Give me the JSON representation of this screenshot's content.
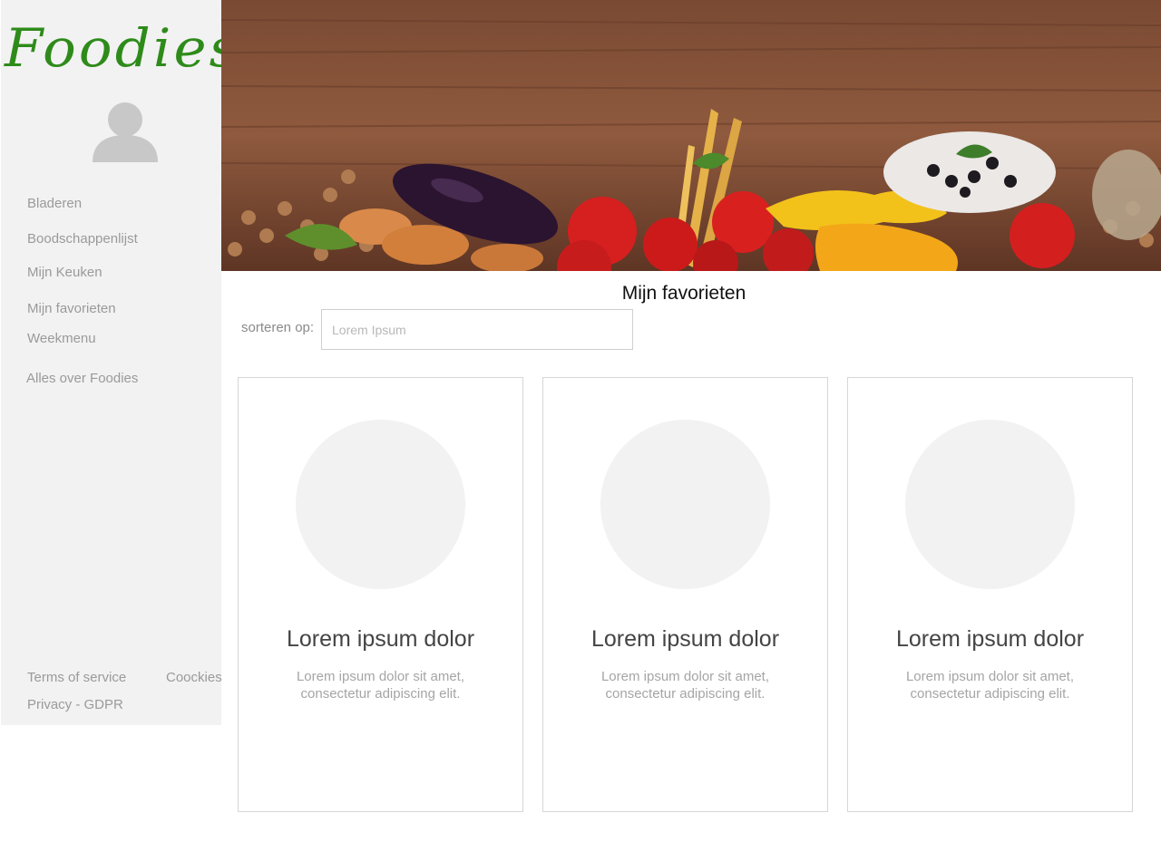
{
  "brand": {
    "logo_text": "Foodies",
    "logo_color": "#2e8b1a"
  },
  "sidebar": {
    "avatar_icon": "user-avatar-icon",
    "items": [
      {
        "label": "Bladeren"
      },
      {
        "label": "Boodschappenlijst"
      },
      {
        "label": "Mijn Keuken"
      },
      {
        "label": "Mijn favorieten"
      },
      {
        "label": "Weekmenu"
      },
      {
        "label": "Alles over Foodies"
      }
    ],
    "footer": {
      "terms": "Terms of service",
      "cookies": "Coockies",
      "privacy": "Privacy - GDPR"
    }
  },
  "hero": {
    "image_subject": "vegetables and pasta on wooden table"
  },
  "main": {
    "title": "Mijn favorieten",
    "sort": {
      "label": "sorteren op:",
      "placeholder": "Lorem Ipsum",
      "value": ""
    },
    "cards": [
      {
        "title": "Lorem ipsum dolor",
        "text": "Lorem ipsum dolor sit amet, consectetur adipiscing elit."
      },
      {
        "title": "Lorem ipsum dolor",
        "text": "Lorem ipsum dolor sit amet, consectetur adipiscing elit."
      },
      {
        "title": "Lorem ipsum dolor",
        "text": "Lorem ipsum dolor sit amet, consectetur adipiscing elit."
      }
    ]
  },
  "colors": {
    "sidebar_bg": "#f2f2f2",
    "placeholder_circle": "#f2f2f2",
    "card_border": "#d6d6d6"
  }
}
